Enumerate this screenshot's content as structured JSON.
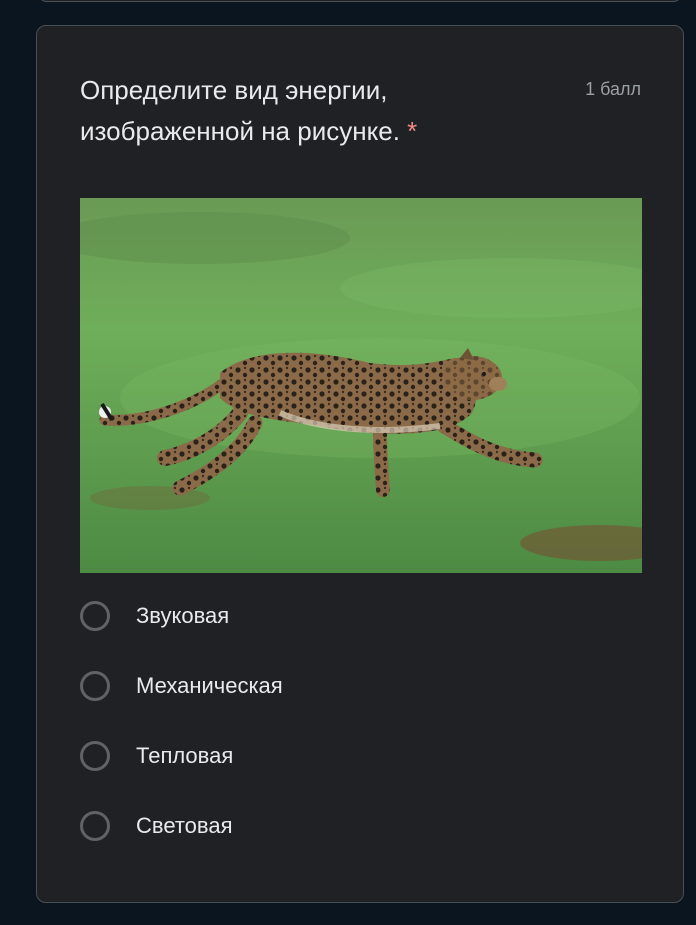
{
  "question": {
    "title": "Определите вид энергии, изображенной на рисунке.",
    "required_marker": "*",
    "points": "1 балл",
    "image_icon": "leopard-running-image"
  },
  "options": [
    {
      "label": "Звуковая"
    },
    {
      "label": "Механическая"
    },
    {
      "label": "Тепловая"
    },
    {
      "label": "Световая"
    }
  ],
  "colors": {
    "background": "#0b1520",
    "card": "#202124",
    "text": "#e8eaed",
    "required": "#f28b82",
    "muted": "#9aa0a6"
  }
}
